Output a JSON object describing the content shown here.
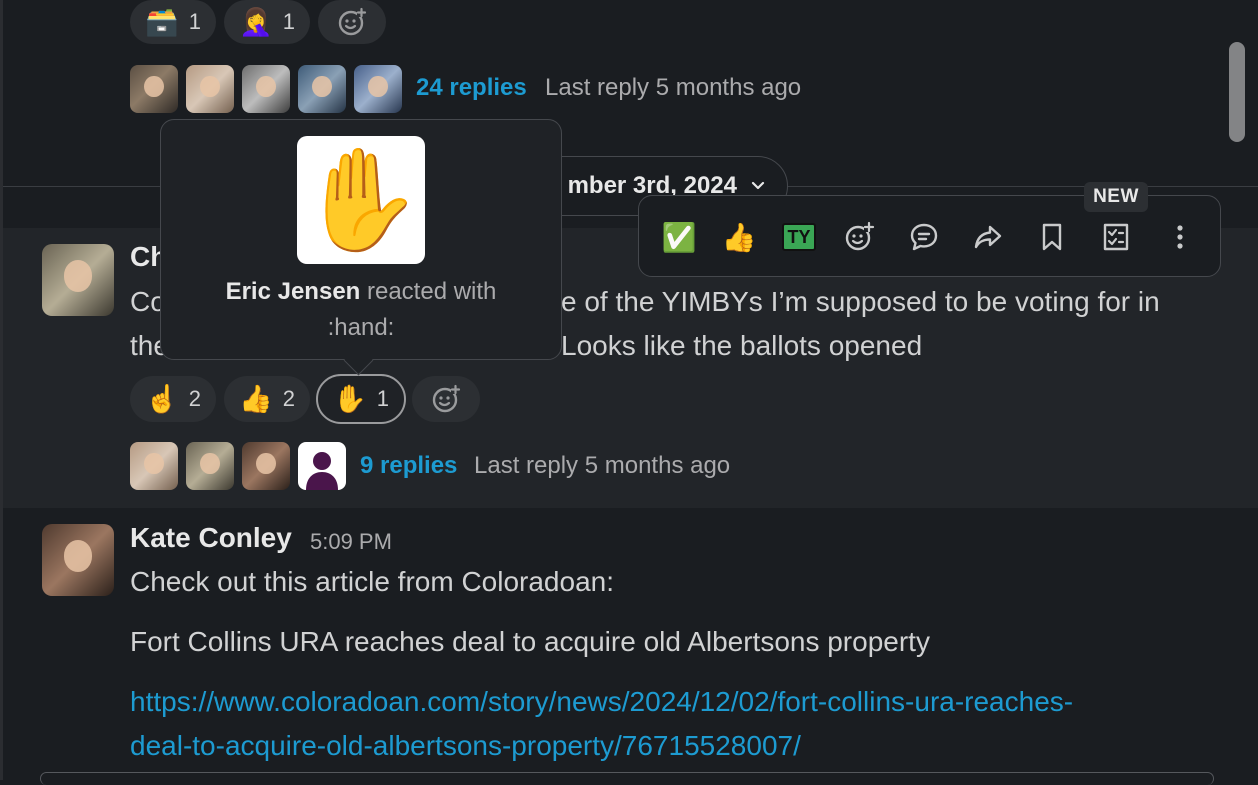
{
  "top_message": {
    "reactions": [
      {
        "emoji": "🗃️",
        "count": "1"
      },
      {
        "emoji": "🤦‍♀️",
        "count": "1"
      }
    ],
    "replies": "24 replies",
    "last_reply": "Last reply 5 months ago"
  },
  "date_divider": {
    "label": "mber 3rd, 2024",
    "chevron": "⌄"
  },
  "toolbar": {
    "new_badge": "NEW",
    "actions": [
      {
        "name": "react-check",
        "glyph": "✅"
      },
      {
        "name": "react-thumbs-up",
        "glyph": "👍"
      },
      {
        "name": "react-ty",
        "glyph": "TY"
      },
      {
        "name": "add-reaction",
        "icon": "add-emoji-icon"
      },
      {
        "name": "reply-in-thread",
        "icon": "comment-icon"
      },
      {
        "name": "forward-message",
        "icon": "share-arrow-icon"
      },
      {
        "name": "save-for-later",
        "icon": "bookmark-icon"
      },
      {
        "name": "turn-into-task",
        "icon": "task-list-icon"
      },
      {
        "name": "more-actions",
        "icon": "kebab-icon"
      }
    ]
  },
  "middle_message": {
    "author": "Ch",
    "lines": [
      "Co",
      "e of the YIMBYs I’m supposed to be voting for in",
      "the",
      "Looks like the ballots opened"
    ],
    "reactions": [
      {
        "emoji": "☝️",
        "count": "2"
      },
      {
        "emoji": "👍",
        "count": "2"
      },
      {
        "emoji": "✋",
        "count": "1"
      }
    ],
    "replies": "9 replies",
    "last_reply": "Last reply 5 months ago"
  },
  "tooltip": {
    "emoji": "✋",
    "user": "Eric Jensen",
    "action": " reacted with",
    "shortcode": ":hand:"
  },
  "bottom_message": {
    "author": "Kate Conley",
    "time": "5:09 PM",
    "line1": "Check out this article from Coloradoan:",
    "line2": "Fort Collins URA reaches deal to acquire old Albertsons property",
    "link_line1": "https://www.coloradoan.com/story/news/2024/12/02/fort-collins-ura-reaches-",
    "link_line2": "deal-to-acquire-old-albertsons-property/76715528007/"
  },
  "colors": {
    "background": "#1a1d21",
    "hover_background": "#222529",
    "link": "#1d9bd1",
    "text": "#d1d2d3",
    "muted": "#ababad"
  }
}
